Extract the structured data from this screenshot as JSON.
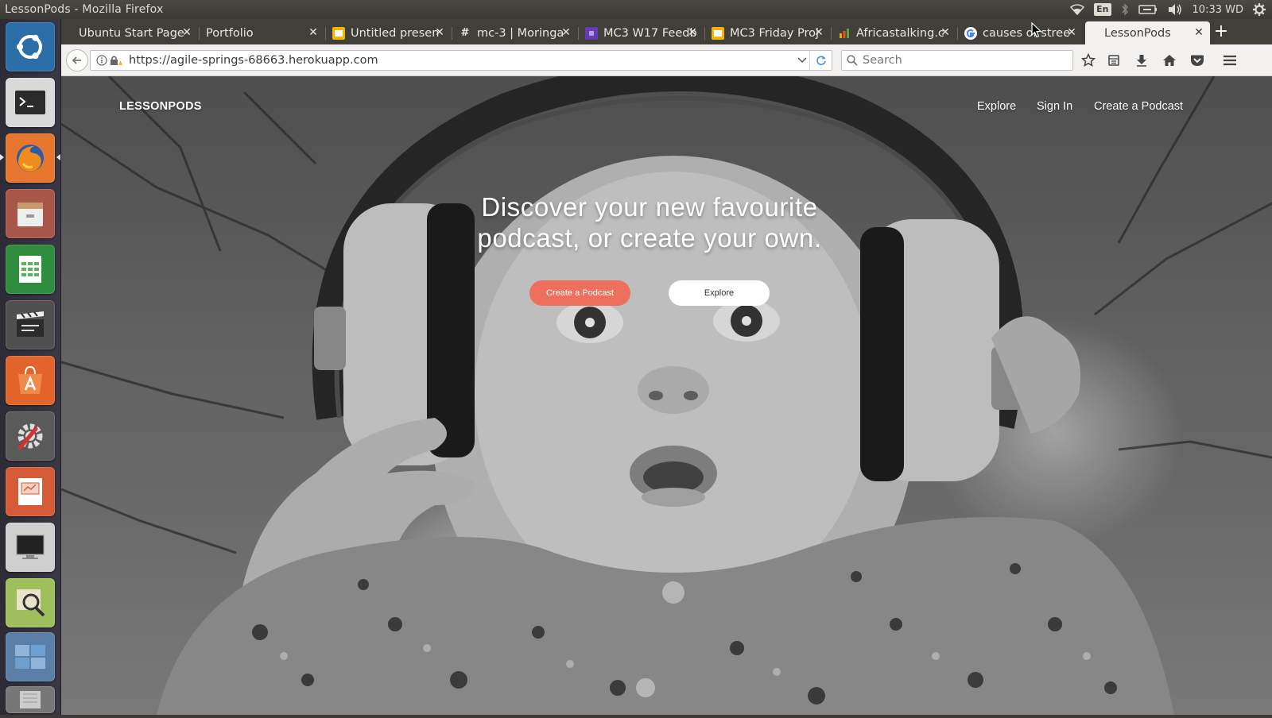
{
  "window": {
    "title": "LessonPods - Mozilla Firefox"
  },
  "indicators": {
    "lang": "En",
    "clock": "10:33 WD"
  },
  "launcher": {
    "items": [
      {
        "name": "ubuntu-dash-icon"
      },
      {
        "name": "terminal-icon"
      },
      {
        "name": "firefox-icon"
      },
      {
        "name": "files-icon"
      },
      {
        "name": "spreadsheet-icon"
      },
      {
        "name": "video-editor-icon"
      },
      {
        "name": "software-center-icon"
      },
      {
        "name": "settings-icon"
      },
      {
        "name": "presentation-icon"
      },
      {
        "name": "display-icon"
      },
      {
        "name": "image-viewer-icon"
      },
      {
        "name": "workspaces-icon"
      }
    ]
  },
  "tabs": [
    {
      "label": "Ubuntu Start Page",
      "favicon": "none"
    },
    {
      "label": "Portfolio",
      "favicon": "none"
    },
    {
      "label": "Untitled presen",
      "favicon": "slides"
    },
    {
      "label": "mc-3 | Moringa",
      "favicon": "hash"
    },
    {
      "label": "MC3 W17 Feedb",
      "favicon": "forms"
    },
    {
      "label": "MC3 Friday Proj",
      "favicon": "slides"
    },
    {
      "label": "Africastalking.c",
      "favicon": "chart"
    },
    {
      "label": "causes of stree",
      "favicon": "google"
    },
    {
      "label": "LessonPods",
      "favicon": "none",
      "active": true
    }
  ],
  "navbar": {
    "url": "https://agile-springs-68663.herokuapp.com",
    "search_placeholder": "Search"
  },
  "site": {
    "brand": "LESSONPODS",
    "nav": {
      "explore": "Explore",
      "sign_in": "Sign In",
      "create": "Create a Podcast"
    },
    "hero_line1": "Discover your new favourite",
    "hero_line2": "podcast, or create your own.",
    "btn_create": "Create a Podcast",
    "btn_explore": "Explore"
  },
  "colors": {
    "accent": "#ef6f5e",
    "panel": "#3c3b37",
    "tab_active": "#f2f1f0"
  }
}
